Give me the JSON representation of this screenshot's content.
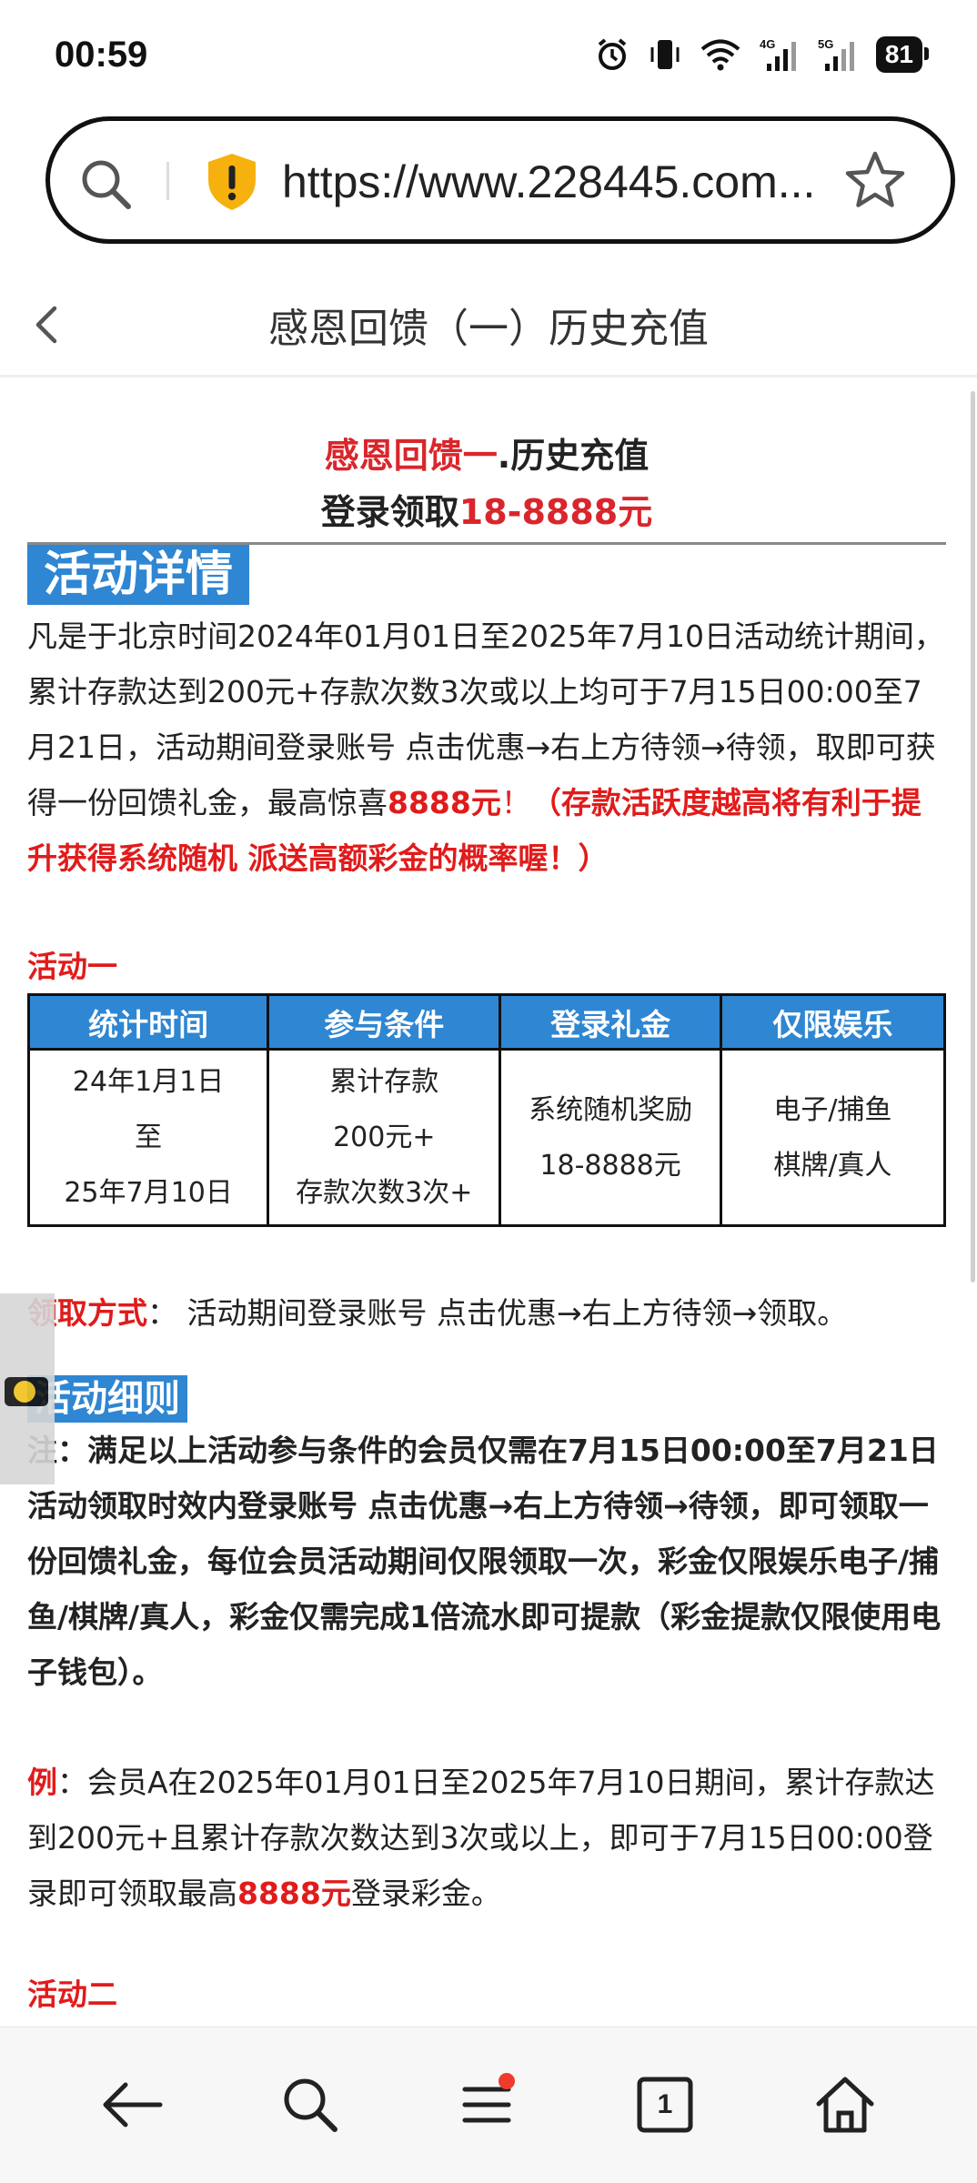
{
  "status_bar": {
    "time": "00:59",
    "icons": [
      "alarm-icon",
      "vibrate-icon",
      "wifi-icon",
      "signal-4g-icon",
      "signal-5g-icon"
    ],
    "network_4g": "4G",
    "network_5g": "5G",
    "battery": "81"
  },
  "browser": {
    "url": "https://www.228445.com...",
    "icons": [
      "search-icon",
      "shield-warning-icon",
      "star-icon"
    ]
  },
  "page_header": {
    "title": "感恩回馈（一）历史充值",
    "back_icon": "chevron-left-icon"
  },
  "hero": {
    "line1_red": "感恩回馈一",
    "line1_black": ".历史充值",
    "line2_black": "登录领取",
    "line2_red": "18-8888元"
  },
  "details": {
    "tag": "活动详情",
    "para_prefix": "凡是于北京时间2024年01月01日至2025年7月10日活动统计期间，累计存款达到200元+存款次数3次或以上均可于7月15日00:00至7月21日，活动期间登录账号 点击优惠→右上方待领→待领，取即可获得一份回馈礼金，最高惊喜",
    "para_amount": "8888元",
    "para_excl": "！",
    "para_red": "（存款活跃度越高将有利于提升获得系统随机 派送高额彩金的概率喔！）"
  },
  "activity_one": {
    "label": "活动一",
    "headers": [
      "统计时间",
      "参与条件",
      "登录礼金",
      "仅限娱乐"
    ],
    "cells": {
      "time": [
        "24年1月1日",
        "至",
        "25年7月10日"
      ],
      "condition": [
        "累计存款",
        "200元+",
        "存款次数3次+"
      ],
      "bonus": [
        "系统随机奖励",
        "18-8888元"
      ],
      "games": [
        "电子/捕鱼",
        "棋牌/真人"
      ]
    }
  },
  "claim": {
    "label": "领取方式",
    "text": "： 活动期间登录账号 点击优惠→右上方待领→领取。"
  },
  "rules": {
    "tag": "活动细则",
    "note": "注：满足以上活动参与条件的会员仅需在7月15日00:00至7月21日活动领取时效内登录账号  点击优惠→右上方待领→待领，即可领取一份回馈礼金，每位会员活动期间仅限领取一次，彩金仅限娱乐电子/捕鱼/棋牌/真人，彩金仅需完成1倍流水即可提款（彩金提款仅限使用电子钱包）。"
  },
  "example": {
    "label": "例",
    "text_pre": "：会员A在2025年01月01日至2025年7月10日期间，累计存款达到200元+且累计存款次数达到3次或以上，即可于7月15日00:00登录即可领取最高",
    "amount": "8888元",
    "text_post": "登录彩金。"
  },
  "activity_two": {
    "label": "活动二"
  },
  "bottom_nav": {
    "items": [
      "back-arrow-icon",
      "search-icon",
      "menu-icon",
      "tabs-icon",
      "home-icon"
    ],
    "tab_count": "1"
  },
  "colors": {
    "accent_blue": "#2f86d2",
    "accent_red": "#e11b1b",
    "dark_red": "#d9262c"
  }
}
